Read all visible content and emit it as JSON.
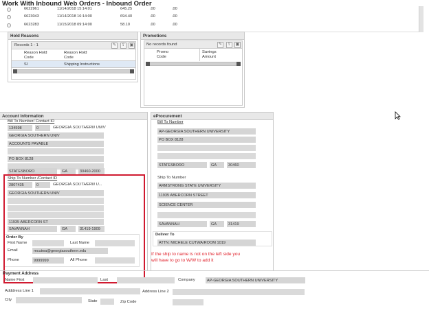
{
  "page": {
    "title": "Work With Inbound Web Orders - Inbound Order"
  },
  "orders": {
    "rows": [
      {
        "id": "6622961",
        "date": "11/14/2018 15:14:01",
        "amount": "645.25",
        "c1": ".00",
        "c2": ".00"
      },
      {
        "id": "6623043",
        "date": "11/14/2018 16:14:00",
        "amount": "694.40",
        "c1": ".00",
        "c2": ".00"
      },
      {
        "id": "6623283",
        "date": "11/15/2018 09:14:00",
        "amount": "58.10",
        "c1": ".00",
        "c2": ".00"
      }
    ]
  },
  "hold_reasons": {
    "title": "Hold Reasons",
    "records": "Records 1 - 1",
    "columns": [
      "Reason Hold Code",
      "Reason Hold Code"
    ],
    "rows": [
      {
        "code": "SI",
        "desc": "Shipping Instructions"
      }
    ]
  },
  "promotions": {
    "title": "Promotions",
    "empty": "No records found",
    "columns": [
      "Promo Code",
      "Savings Amount"
    ]
  },
  "account_info": {
    "title": "Account Information",
    "bill_to_label": "Bill To Number/ Contact ID",
    "bill_to": {
      "number": "134598",
      "contact": "0",
      "name": "GEORGIA SOUTHERN UNIV",
      "line1": "GEORGIA SOUTHERN UNIV",
      "line2": "ACCOUNTS  PAYABLE",
      "line3": "",
      "line4": "PO BOX 8128",
      "line5": "",
      "city": "STATESBORO",
      "state": "GA",
      "zip": "30460-2000"
    },
    "ship_to_label": "Ship To Number /Contact ID",
    "ship_to": {
      "number": "2807435",
      "contact": "0",
      "name": "GEORGIA SOUTHERN U...",
      "line1": "GEORGIA SOUTHERN UNIV",
      "line2": "",
      "line3": "",
      "line4": "",
      "line5": "11935 ABERCORN ST",
      "city": "SAVANNAH",
      "state": "GA",
      "zip": "31419-1909"
    },
    "order_by": {
      "title": "Order By",
      "first_name_label": "First Name",
      "last_name_label": "Last Name",
      "email_label": "Email",
      "email": "mcutwa@georgiasouthern.edu",
      "phone_label": "Phone",
      "phone": "9999999",
      "all_phone_label": "All Phone"
    }
  },
  "eprocurement": {
    "title": "eProcurement",
    "bill_to_label": "Bill To Number",
    "bill_to": {
      "line1": "AP-GEORGIA SOUTHERN UNIVERSITY",
      "line2": "PO BOX 8128",
      "city": "STATESBORO",
      "state": "GA",
      "zip": "30460"
    },
    "ship_to_label": "Ship To Number",
    "ship_to": {
      "line1": "ARMSTRONG STATE UNIVERSITY",
      "line2": "11935 ABERCORN STREET",
      "line3": "SCIENCE CENTER",
      "city": "SAVANNAH",
      "state": "GA",
      "zip": "31419"
    },
    "deliver_to_label": "Deliver To",
    "deliver_to": "ATTN: MICHELE CUTWA/ROOM 1019"
  },
  "annotation": {
    "line1": "If the ship to name is not on the left side you",
    "line2": "will have to go to W/W to add it"
  },
  "payment": {
    "title": "Payment Address",
    "name_first_label": "Name First",
    "last_label": "Last",
    "company_label": "Company",
    "company": "AP-GEORGIA SOUTHERN UNIVERSITY",
    "address1_label": "Adddress Line 1",
    "address2_label": "Address Line 2",
    "city_label": "City",
    "state_label": "State",
    "zip_label": "Zip Code"
  },
  "colors": {
    "annotation": "#d0192f",
    "field": "#d5d5d5",
    "panel_header": "#e8e8e8"
  }
}
